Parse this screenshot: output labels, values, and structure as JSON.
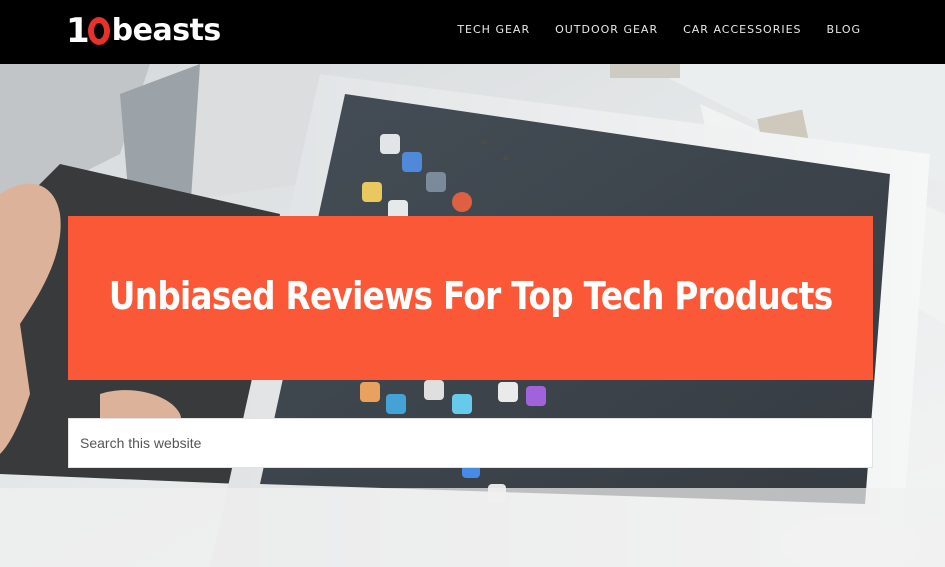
{
  "header": {
    "logo": {
      "one": "1",
      "word": "beasts"
    },
    "nav": [
      {
        "label": "TECH GEAR"
      },
      {
        "label": "OUTDOOR GEAR"
      },
      {
        "label": "CAR ACCESSORIES"
      },
      {
        "label": "BLOG"
      }
    ]
  },
  "hero": {
    "title": "Unbiased Reviews For Top Tech Products"
  },
  "search": {
    "placeholder": "Search this website",
    "value": ""
  },
  "colors": {
    "header_bg": "#000000",
    "banner_accent": "#fb5837",
    "logo_accent": "#e6322a"
  }
}
